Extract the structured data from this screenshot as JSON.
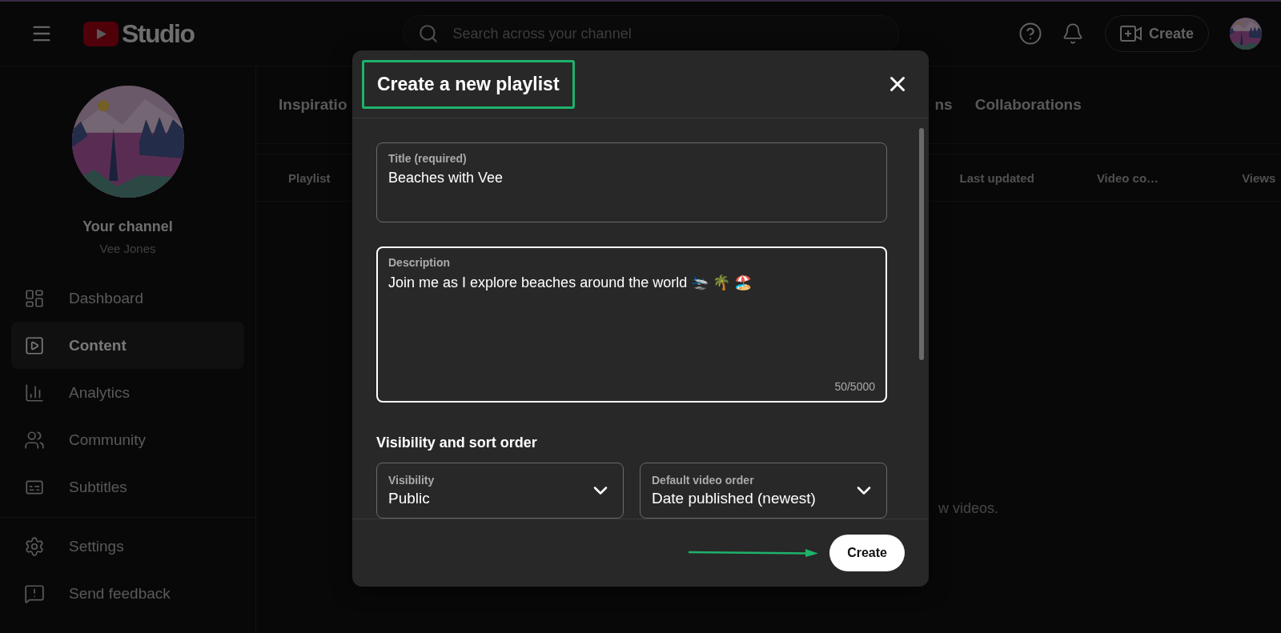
{
  "header": {
    "logo_text": "Studio",
    "search": {
      "placeholder": "Search across your channel"
    },
    "create_button": "Create"
  },
  "sidebar": {
    "channel_title": "Your channel",
    "channel_name": "Vee Jones",
    "items": [
      {
        "kind": "dashboard",
        "label": "Dashboard",
        "selected": false
      },
      {
        "kind": "content",
        "label": "Content",
        "selected": true
      },
      {
        "kind": "analytics",
        "label": "Analytics",
        "selected": false
      },
      {
        "kind": "community",
        "label": "Community",
        "selected": false
      },
      {
        "kind": "subtitles",
        "label": "Subtitles",
        "selected": false
      }
    ],
    "footer_items": [
      {
        "kind": "settings",
        "label": "Settings"
      },
      {
        "kind": "feedback",
        "label": "Send feedback"
      }
    ]
  },
  "content": {
    "tabs": [
      "Inspiratio",
      "ns",
      "Collaborations"
    ],
    "columns": [
      "Playlist",
      "Last updated",
      "Video co…",
      "Views"
    ],
    "empty_message": "w videos."
  },
  "dialog": {
    "title": {
      "text": "Create a new playlist",
      "highlighted": true
    },
    "title_field": {
      "label": "Title (required)",
      "value": "Beaches with Vee",
      "focused": false
    },
    "description_field": {
      "label": "Description",
      "value": "Join me as I explore beaches around the world 🛬 🌴 🏖️",
      "counter": "50/5000",
      "focused": true
    },
    "section_heading": "Visibility and sort order",
    "selects": [
      {
        "label": "Visibility",
        "value": "Public"
      },
      {
        "label": "Default video order",
        "value": "Date published (newest)"
      }
    ],
    "create_button": {
      "label": "Create",
      "pointer_arrow": true
    }
  }
}
